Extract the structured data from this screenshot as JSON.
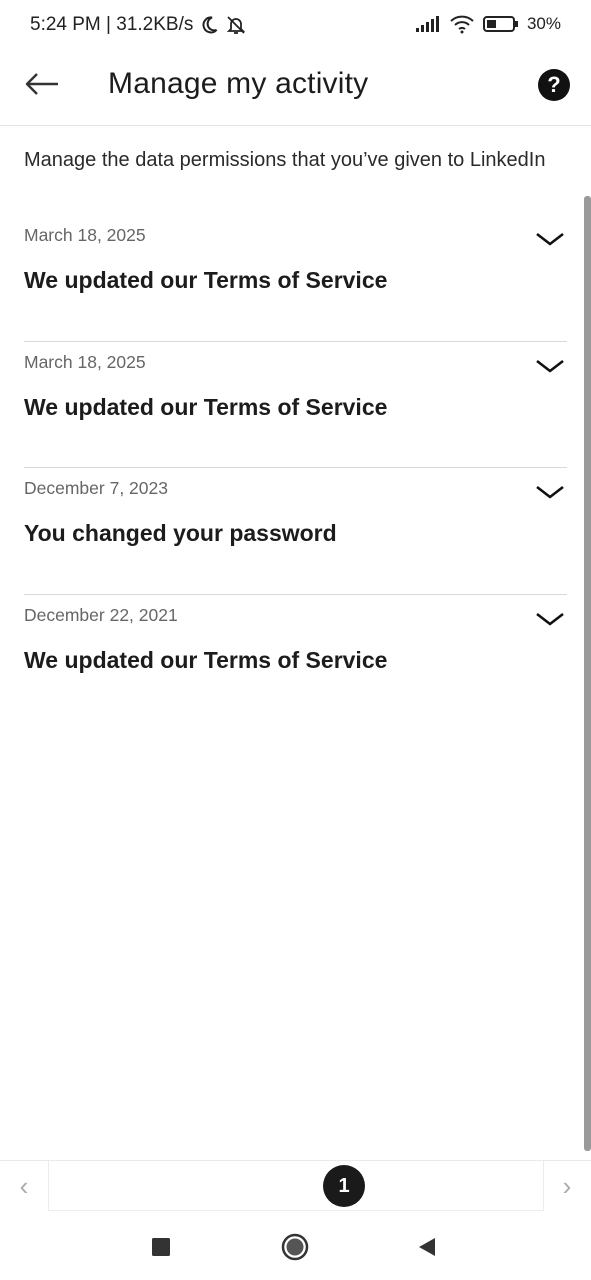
{
  "status_bar": {
    "time_speed": "5:24 PM | 31.2KB/s",
    "battery": "30%",
    "icons": [
      "moon-icon",
      "bell-muted-icon",
      "signal-icon",
      "wifi-icon",
      "battery-icon"
    ]
  },
  "header": {
    "title": "Manage my activity",
    "back_icon": "arrow-left-icon",
    "help_label": "?"
  },
  "intro": "Manage the data permissions that you’ve given to LinkedIn",
  "activities": [
    {
      "date": "March 18, 2025",
      "title": "We updated our Terms of Service"
    },
    {
      "date": "March 18, 2025",
      "title": "We updated our Terms of Service"
    },
    {
      "date": "December 7, 2023",
      "title": "You changed your password"
    },
    {
      "date": "December 22, 2021",
      "title": "We updated our Terms of Service"
    }
  ],
  "pager": {
    "prev": "‹",
    "next": "›",
    "current_page": "1"
  },
  "colors": {
    "text_primary": "#1c1c1c",
    "text_secondary": "#666666",
    "divider": "#d8d8d8",
    "badge": "#1a1a1a"
  }
}
